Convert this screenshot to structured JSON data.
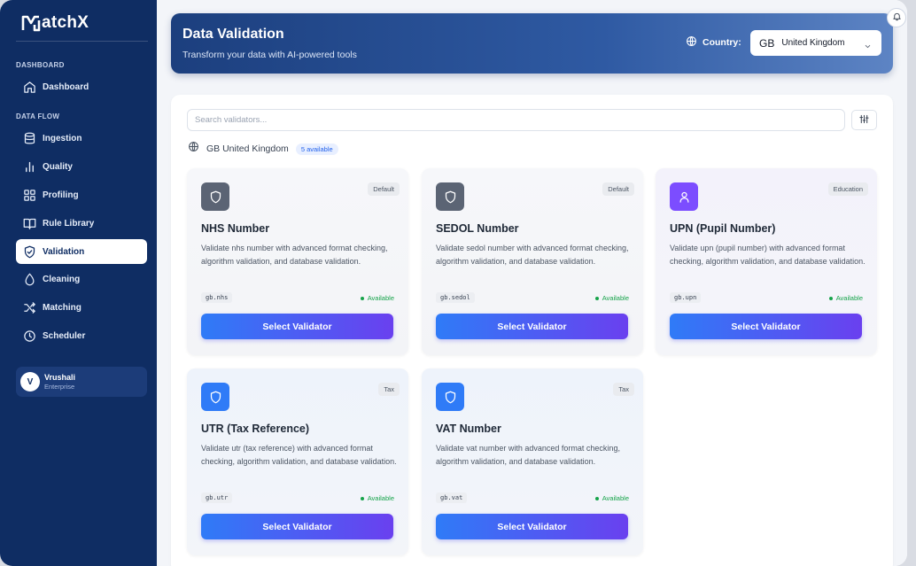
{
  "app": {
    "logo_text": "atchX"
  },
  "sidebar": {
    "sections": [
      {
        "label": "DASHBOARD"
      },
      {
        "label": "DATA FLOW"
      }
    ],
    "items": [
      {
        "label": "Dashboard",
        "icon": "home-icon"
      },
      {
        "label": "Ingestion",
        "icon": "database-icon"
      },
      {
        "label": "Quality",
        "icon": "bar-chart-icon"
      },
      {
        "label": "Profiling",
        "icon": "grid-icon"
      },
      {
        "label": "Rule Library",
        "icon": "book-icon"
      },
      {
        "label": "Validation",
        "icon": "shield-check-icon",
        "active": true
      },
      {
        "label": "Cleaning",
        "icon": "droplet-icon"
      },
      {
        "label": "Matching",
        "icon": "shuffle-icon"
      },
      {
        "label": "Scheduler",
        "icon": "clock-icon"
      }
    ],
    "user": {
      "initial": "V",
      "name": "Vrushali",
      "plan": "Enterprise"
    }
  },
  "header": {
    "title": "Data Validation",
    "subtitle": "Transform your data with AI-powered tools",
    "country_label": "Country:",
    "country_code": "GB",
    "country_name": "United Kingdom"
  },
  "search": {
    "placeholder": "Search validators..."
  },
  "region": {
    "text": "GB United Kingdom",
    "count": "5 available"
  },
  "cards": [
    {
      "title": "NHS Number",
      "tag": "Default",
      "description": "Validate nhs number with advanced format checking, algorithm validation, and database validation.",
      "code": "gb.nhs",
      "status": "Available",
      "button": "Select Validator",
      "icon_color": "#5b6474"
    },
    {
      "title": "SEDOL Number",
      "tag": "Default",
      "description": "Validate sedol number with advanced format checking, algorithm validation, and database validation.",
      "code": "gb.sedol",
      "status": "Available",
      "button": "Select Validator",
      "icon_color": "#5b6474"
    },
    {
      "title": "UPN (Pupil Number)",
      "tag": "Education",
      "description": "Validate upn (pupil number) with advanced format checking, algorithm validation, and database validation.",
      "code": "gb.upn",
      "status": "Available",
      "button": "Select Validator",
      "icon_color": "#7c4dff"
    },
    {
      "title": "UTR (Tax Reference)",
      "tag": "Tax",
      "description": "Validate utr (tax reference) with advanced format checking, algorithm validation, and database validation.",
      "code": "gb.utr",
      "status": "Available",
      "button": "Select Validator",
      "icon_color": "#2f7bf7"
    },
    {
      "title": "VAT Number",
      "tag": "Tax",
      "description": "Validate vat number with advanced format checking, algorithm validation, and database validation.",
      "code": "gb.vat",
      "status": "Available",
      "button": "Select Validator",
      "icon_color": "#2f7bf7"
    }
  ]
}
